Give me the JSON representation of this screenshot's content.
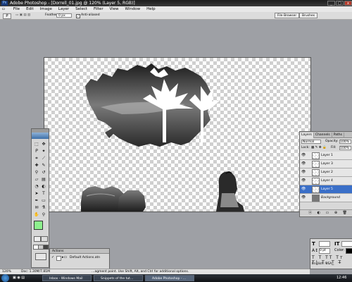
{
  "window": {
    "title": "Adobe Photoshop - [Dorrell_01.jpg @ 120% (Layer 5, RGB)]"
  },
  "menu": [
    "File",
    "Edit",
    "Image",
    "Layer",
    "Select",
    "Filter",
    "View",
    "Window",
    "Help"
  ],
  "options": {
    "feather_label": "Feather:",
    "feather_value": "0 px",
    "antialias_label": "Anti-aliased",
    "file_browser": "File Browser",
    "brushes": "Brushes"
  },
  "layers": {
    "tabs": [
      "Layers",
      "Channels",
      "Paths"
    ],
    "mode": "Normal",
    "opacity_label": "Opacity:",
    "opacity_value": "100%",
    "lock_label": "Lock:",
    "fill_label": "Fill:",
    "fill_value": "100%",
    "items": [
      {
        "name": "Layer 1"
      },
      {
        "name": "Layer 3"
      },
      {
        "name": "Layer 2"
      },
      {
        "name": "Layer 4"
      },
      {
        "name": "Layer 5"
      },
      {
        "name": "Background"
      }
    ]
  },
  "actions": {
    "title": "Actions",
    "item": "Default Actions.atn"
  },
  "status": {
    "zoom": "120%",
    "doc": "Doc: 1.30M/7.81M",
    "hint": "…agment point. Use Shift, Alt, and Ctrl for additional options."
  },
  "char_panel": {
    "language": "English: USA",
    "size": "0 pt"
  },
  "taskbar": {
    "items": [
      "Inbox - Windows Mail",
      "Snippets of the tut...",
      "Adobe Photoshop - ..."
    ],
    "time": "12:46"
  },
  "colors": {
    "foreground": "#8df08d",
    "background": "#ffffff",
    "selection": "#3a6fc8"
  }
}
